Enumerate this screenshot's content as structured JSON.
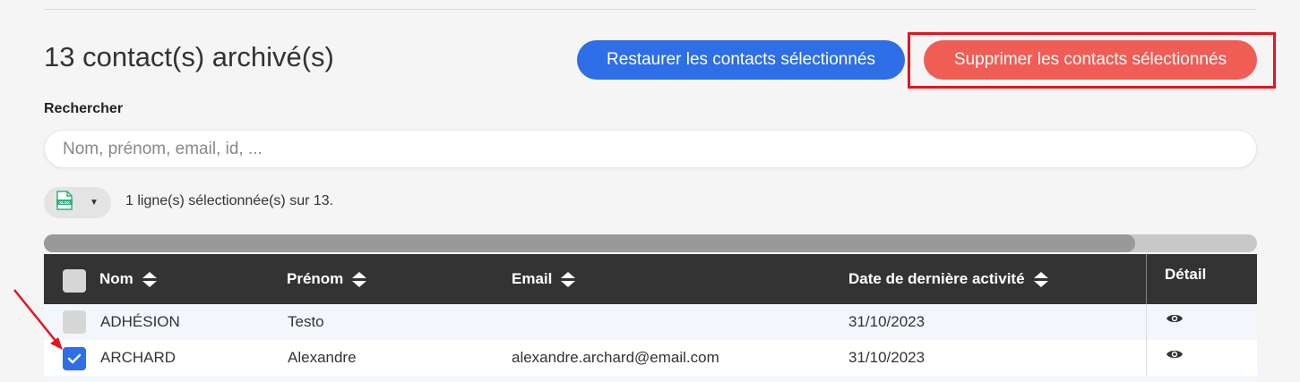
{
  "header": {
    "title": "13 contact(s) archivé(s)",
    "restore_label": "Restaurer les contacts sélectionnés",
    "delete_label": "Supprimer les contacts sélectionnés"
  },
  "search": {
    "label": "Rechercher",
    "placeholder": "Nom, prénom, email, id, ...",
    "value": ""
  },
  "toolbar": {
    "export_icon": "xlsx-file-icon",
    "export_icon_text": "XLSX",
    "selection_text": "1 ligne(s) sélectionnée(s) sur 13."
  },
  "table": {
    "columns": [
      "Nom",
      "Prénom",
      "Email",
      "Date de dernière activité",
      "Détail"
    ],
    "rows": [
      {
        "nom": "ADHÉSION",
        "prenom": "Testo",
        "email": "",
        "date": "31/10/2023",
        "checked": false
      },
      {
        "nom": "ARCHARD",
        "prenom": "Alexandre",
        "email": "alexandre.archard@email.com",
        "date": "31/10/2023",
        "checked": true
      }
    ]
  },
  "scrollbar": {
    "position": 0.9
  },
  "colors": {
    "primary": "#2e6ee6",
    "danger": "#ef5d55",
    "highlight": "#e8131b",
    "header_bg": "#333333"
  }
}
